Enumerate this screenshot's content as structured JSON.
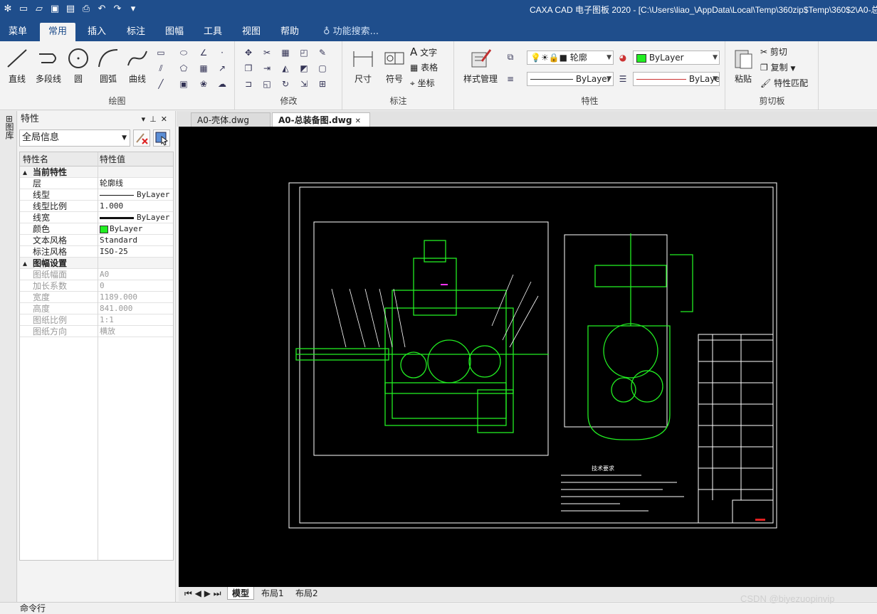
{
  "window": {
    "title": "CAXA CAD 电子图板 2020 - [C:\\Users\\liao_\\AppData\\Local\\Temp\\360zip$Temp\\360$2\\A0-总"
  },
  "menu": {
    "tabs": [
      "菜单",
      "常用",
      "插入",
      "标注",
      "图幅",
      "工具",
      "视图",
      "帮助"
    ],
    "active": "常用",
    "search": "功能搜索..."
  },
  "ribbon": {
    "draw": {
      "label": "绘图",
      "line": "直线",
      "polyline": "多段线",
      "circle": "圆",
      "arc": "圆弧",
      "curve": "曲线"
    },
    "modify": {
      "label": "修改"
    },
    "annot": {
      "label": "标注",
      "dim": "尺寸",
      "symbol": "符号",
      "text": "文字",
      "table": "表格",
      "coord": "坐标"
    },
    "props": {
      "label": "特性",
      "style": "样式管理",
      "layer": "轮廓",
      "color": "ByLayer",
      "linetype": "ByLayer",
      "lineweight": "ByLayer"
    },
    "clip": {
      "label": "剪切板",
      "paste": "粘贴",
      "cut": "剪切",
      "copy": "复制",
      "match": "特性匹配"
    }
  },
  "left_strip": {
    "label": "图库"
  },
  "panel": {
    "title": "特性",
    "selector": "全局信息",
    "col_name": "特性名",
    "col_value": "特性值",
    "rows": [
      {
        "k": "当前特性",
        "cat": true
      },
      {
        "k": "层",
        "v": "轮廓线"
      },
      {
        "k": "线型",
        "v": "ByLayer"
      },
      {
        "k": "线型比例",
        "v": "1.000"
      },
      {
        "k": "线宽",
        "v": "ByLayer"
      },
      {
        "k": "颜色",
        "v": "ByLayer"
      },
      {
        "k": "文本风格",
        "v": "Standard"
      },
      {
        "k": "标注风格",
        "v": "ISO-25"
      },
      {
        "k": "图幅设置",
        "cat": true
      },
      {
        "k": "图纸幅面",
        "v": "A0",
        "dis": true
      },
      {
        "k": "加长系数",
        "v": "0",
        "dis": true
      },
      {
        "k": "宽度",
        "v": "1189.000",
        "dis": true
      },
      {
        "k": "高度",
        "v": "841.000",
        "dis": true
      },
      {
        "k": "图纸比例",
        "v": "1:1",
        "dis": true
      },
      {
        "k": "图纸方向",
        "v": "横放",
        "dis": true
      }
    ]
  },
  "docs": {
    "tabs": [
      "A0-壳体.dwg",
      "A0-总装备图.dwg"
    ],
    "active": "A0-总装备图.dwg"
  },
  "drawing": {
    "note_title": "技术要求"
  },
  "layouts": {
    "tabs": [
      "模型",
      "布局1",
      "布局2"
    ],
    "active": "模型"
  },
  "command": {
    "label": "命令行"
  },
  "watermark": "CSDN @biyezuopinvip",
  "colors": {
    "titlebar": "#1f4e8c",
    "canvas": "#000000",
    "line_white": "#ffffff",
    "line_green": "#22ee22",
    "accent_magenta": "#ff33ff"
  }
}
